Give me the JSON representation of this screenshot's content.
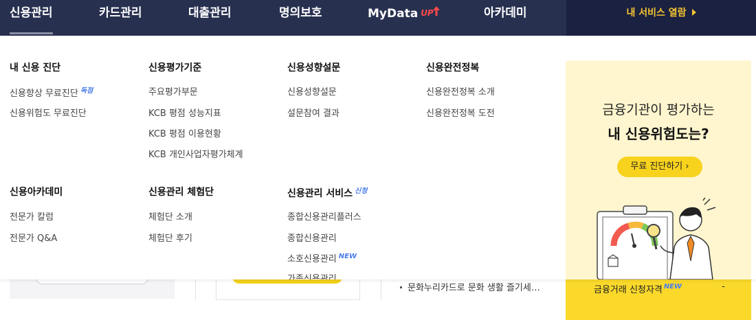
{
  "nav": {
    "items": [
      {
        "label": "신용관리"
      },
      {
        "label": "카드관리"
      },
      {
        "label": "대출관리"
      },
      {
        "label": "명의보호"
      },
      {
        "label": "MyData",
        "badge": "UP"
      },
      {
        "label": "아카데미"
      }
    ],
    "service_button": "내 서비스 열람"
  },
  "menu": {
    "col1_head": "내 신용 진단",
    "col1_links": [
      "신용향상 무료진단",
      "신용위험도 무료진단"
    ],
    "col1_tag": "독점",
    "col2_head": "신용평가기준",
    "col2_links": [
      "주요평가부문",
      "KCB 평점 성능지표",
      "KCB 평점 이용현황",
      "KCB 개인사업자평가체계"
    ],
    "col3_head": "신용성향설문",
    "col3_links": [
      "신용성향설문",
      "설문참여 결과"
    ],
    "col4_head": "신용완전정복",
    "col4_links": [
      "신용완전정복 소개",
      "신용완전정복 도전"
    ],
    "col5_head": "신용아카데미",
    "col5_links": [
      "전문가 칼럼",
      "전문가 Q&A"
    ],
    "col6_head": "신용관리 체험단",
    "col6_links": [
      "체험단 소개",
      "체험단 후기"
    ],
    "col7_head": "신용관리 서비스",
    "col7_head_tag": "신청",
    "col7_links": [
      "종합신용관리플러스",
      "종합신용관리",
      "소호신용관리",
      "가족신용관리"
    ],
    "col7_new_tag": "NEW"
  },
  "promo": {
    "line1": "금융기관이 평가하는",
    "line2": "내 신용위험도는?",
    "button": "무료 진단하기 ›"
  },
  "background": {
    "news_item": "문화누리카드로 문화 생활 즐기세…",
    "yellow_text": "금융거래 신청자격",
    "yellow_tag": "NEW",
    "yellow_dash": "-"
  },
  "colors": {
    "nav_bg": "#283050",
    "accent_yellow": "#f8d31e",
    "tag_blue": "#4a7de8",
    "mydata_red": "#ff4a4a"
  }
}
